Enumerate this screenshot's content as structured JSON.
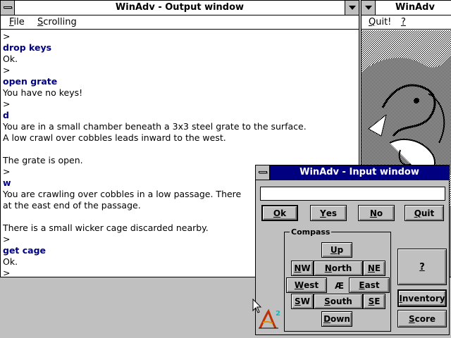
{
  "output_window": {
    "title": "WinAdv - Output window",
    "menu": [
      {
        "label": "File",
        "underline": "F",
        "rest": "ile"
      },
      {
        "label": "Scrolling",
        "underline": "S",
        "rest": "crolling"
      }
    ],
    "lines": [
      {
        "text": ">",
        "type": "prompt"
      },
      {
        "text": "drop keys",
        "type": "cmd"
      },
      {
        "text": "Ok.",
        "type": "out"
      },
      {
        "text": ">",
        "type": "prompt"
      },
      {
        "text": "open grate",
        "type": "cmd"
      },
      {
        "text": "You have no keys!",
        "type": "out"
      },
      {
        "text": ">",
        "type": "prompt"
      },
      {
        "text": "d",
        "type": "cmd"
      },
      {
        "text": "You are in a small chamber beneath a 3x3 steel grate to the surface.",
        "type": "out"
      },
      {
        "text": "A low crawl over cobbles leads inward to the west.",
        "type": "out"
      },
      {
        "text": "",
        "type": "out"
      },
      {
        "text": "The grate is open.",
        "type": "out"
      },
      {
        "text": ">",
        "type": "prompt"
      },
      {
        "text": "w",
        "type": "cmd"
      },
      {
        "text": "You are crawling over cobbles in a low passage. There",
        "type": "out"
      },
      {
        "text": "at the east end of the passage.",
        "type": "out"
      },
      {
        "text": "",
        "type": "out"
      },
      {
        "text": "There is a small wicker cage discarded nearby.",
        "type": "out"
      },
      {
        "text": ">",
        "type": "prompt"
      },
      {
        "text": "get cage",
        "type": "cmd"
      },
      {
        "text": "Ok.",
        "type": "out"
      },
      {
        "text": ">",
        "type": "prompt"
      }
    ]
  },
  "picture_window": {
    "title": "WinAdv",
    "menu": [
      {
        "label": "Quit!",
        "underline": "Q",
        "rest": "uit!"
      },
      {
        "label": "?",
        "underline": "?",
        "rest": ""
      }
    ]
  },
  "input_window": {
    "title": "WinAdv - Input window",
    "input_value": "",
    "buttons": {
      "ok": {
        "u": "O",
        "rest": "k"
      },
      "yes": {
        "u": "Y",
        "rest": "es"
      },
      "no": {
        "u": "N",
        "rest": "o"
      },
      "quit": {
        "u": "Q",
        "rest": "uit"
      },
      "help": {
        "u": "?",
        "rest": ""
      },
      "inventory": {
        "u": "I",
        "rest": "nventory"
      },
      "score": {
        "u": "S",
        "rest": "core"
      }
    },
    "compass": {
      "label": "Compass",
      "center": "Æ",
      "up": {
        "u": "U",
        "rest": "p"
      },
      "down": {
        "u": "D",
        "rest": "own"
      },
      "north": {
        "u": "N",
        "rest": "orth"
      },
      "south": {
        "u": "S",
        "rest": "outh"
      },
      "east": {
        "u": "E",
        "rest": "ast"
      },
      "west": {
        "u": "W",
        "rest": "est"
      },
      "nw": {
        "u": "N",
        "rest": "W"
      },
      "ne": {
        "u": "N",
        "rest": "E"
      },
      "sw": {
        "u": "S",
        "rest": "W"
      },
      "se": {
        "u": "S",
        "rest": "E"
      }
    }
  },
  "logo": {
    "letter": "A",
    "superscript": "2"
  },
  "colors": {
    "title_active": "#000080",
    "command_text": "#000080",
    "face": "#c0c0c0"
  }
}
